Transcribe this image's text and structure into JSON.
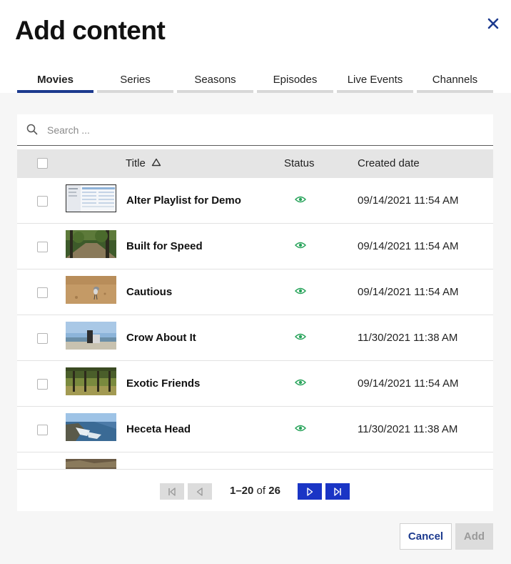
{
  "dialog": {
    "title": "Add content",
    "close_icon": "close-icon"
  },
  "tabs": [
    {
      "label": "Movies",
      "active": true
    },
    {
      "label": "Series",
      "active": false
    },
    {
      "label": "Seasons",
      "active": false
    },
    {
      "label": "Episodes",
      "active": false
    },
    {
      "label": "Live Events",
      "active": false
    },
    {
      "label": "Channels",
      "active": false
    }
  ],
  "search": {
    "placeholder": "Search ...",
    "value": "",
    "icon": "search-icon"
  },
  "table": {
    "columns": {
      "title": "Title",
      "status": "Status",
      "created": "Created date"
    },
    "sort": {
      "column": "title",
      "direction": "ascending",
      "icon": "sort-up-icon"
    },
    "rows": [
      {
        "title": "Alter Playlist for Demo",
        "status_icon": "eye-icon",
        "created": "09/14/2021 11:54 AM",
        "thumbnail": "screenshot-thumbnail"
      },
      {
        "title": "Built for Speed",
        "status_icon": "eye-icon",
        "created": "09/14/2021 11:54 AM",
        "thumbnail": "forest-path-thumbnail"
      },
      {
        "title": "Cautious",
        "status_icon": "eye-icon",
        "created": "09/14/2021 11:54 AM",
        "thumbnail": "bird-sand-thumbnail"
      },
      {
        "title": "Crow About It",
        "status_icon": "eye-icon",
        "created": "11/30/2021 11:38 AM",
        "thumbnail": "coast-sky-thumbnail"
      },
      {
        "title": "Exotic Friends",
        "status_icon": "eye-icon",
        "created": "09/14/2021 11:54 AM",
        "thumbnail": "palm-trees-thumbnail"
      },
      {
        "title": "Heceta Head",
        "status_icon": "eye-icon",
        "created": "11/30/2021 11:38 AM",
        "thumbnail": "coastline-thumbnail"
      },
      {
        "title": "",
        "status_icon": "",
        "created": "",
        "thumbnail": "ground-thumbnail"
      }
    ]
  },
  "pagination": {
    "range": "1–20",
    "of_label": "of",
    "total": "26"
  },
  "actions": {
    "cancel": "Cancel",
    "add": "Add"
  },
  "colors": {
    "accent": "#1c3a8e",
    "pager_active": "#1a35c5",
    "status_green": "#27a35a",
    "header_row": "#e5e5e5"
  }
}
